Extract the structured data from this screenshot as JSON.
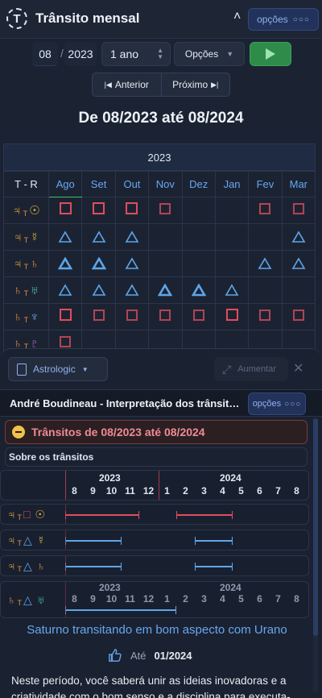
{
  "header": {
    "logo": "T",
    "title": "Trânsito mensal",
    "options_label": "opções"
  },
  "controls": {
    "month": "08",
    "year": "2023",
    "period": "1 ano",
    "options_select": "Opções",
    "prev_label": "Anterior",
    "next_label": "Próximo"
  },
  "range_title": "De 08/2023 até 08/2024",
  "grid": {
    "year": "2023",
    "corner": "T - R",
    "months": [
      "Ago",
      "Set",
      "Out",
      "Nov",
      "Dez",
      "Jan",
      "Fev",
      "Mar"
    ],
    "rows": [
      {
        "t": "♃",
        "r": "☉",
        "t_class": "jup",
        "r_class": "sun",
        "cells": [
          "sq",
          "sq",
          "sq",
          "sqd",
          "",
          "",
          "sqd",
          "sqd"
        ]
      },
      {
        "t": "♃",
        "r": "☿",
        "t_class": "jup",
        "r_class": "mer",
        "cells": [
          "tri",
          "tri",
          "tri",
          "",
          "",
          "",
          "",
          "tri"
        ]
      },
      {
        "t": "♃",
        "r": "♄",
        "t_class": "jup",
        "r_class": "sat",
        "cells": [
          "triB",
          "triB",
          "tri",
          "",
          "",
          "",
          "tri",
          "tri"
        ]
      },
      {
        "t": "♄",
        "r": "♅",
        "t_class": "sat",
        "r_class": "ura",
        "cells": [
          "tri",
          "tri",
          "tri",
          "triB",
          "triB",
          "tri",
          "",
          ""
        ]
      },
      {
        "t": "♄",
        "r": "♆",
        "t_class": "sat",
        "r_class": "nep",
        "cells": [
          "sq",
          "sqd",
          "sqd",
          "sqd",
          "sqd",
          "sq",
          "sqd",
          "sqd"
        ]
      },
      {
        "t": "♄",
        "r": "♇",
        "t_class": "sat",
        "r_class": "plu",
        "cells": [
          "sqd",
          "",
          "",
          "",
          "",
          "",
          "",
          ""
        ]
      }
    ]
  },
  "panel": {
    "astrologic_label": "Astrologic",
    "aumentar_label": "Aumentar",
    "sub_title": "André Boudineau - Interpretação dos trânsitos ...",
    "options_label": "opções",
    "transits_head": "Trânsitos de 08/2023 até 08/2024",
    "about_label": "Sobre os trânsitos",
    "timeline": {
      "year_a": "2023",
      "year_b": "2024",
      "months": [
        "8",
        "9",
        "10",
        "11",
        "12",
        "1",
        "2",
        "3",
        "4",
        "5",
        "6",
        "7",
        "8"
      ],
      "rows": [
        {
          "t": "♃",
          "asp": "□",
          "r": "☉",
          "t_class": "jup",
          "r_class": "sun",
          "color": "red"
        },
        {
          "t": "♃",
          "asp": "△",
          "r": "☿",
          "t_class": "jup",
          "r_class": "mer",
          "color": "blue"
        },
        {
          "t": "♃",
          "asp": "△",
          "r": "♄",
          "t_class": "jup",
          "r_class": "sat",
          "color": "blue"
        },
        {
          "t": "♄",
          "asp": "△",
          "r": "♅",
          "t_class": "sat",
          "r_class": "ura",
          "color": "blue"
        }
      ]
    },
    "interp_title": "Saturno transitando em bom aspecto com Urano",
    "until_label": "Até",
    "until_date": "01/2024",
    "paragraph": "Neste período, você saberá unir as ideias inovadoras e a criatividade com o bom senso e a disciplina para executa-las"
  },
  "colors": {
    "accent": "#67a7ef",
    "square": "#e24c5c",
    "trine": "#5ea6ea",
    "play": "#2e8b48"
  }
}
